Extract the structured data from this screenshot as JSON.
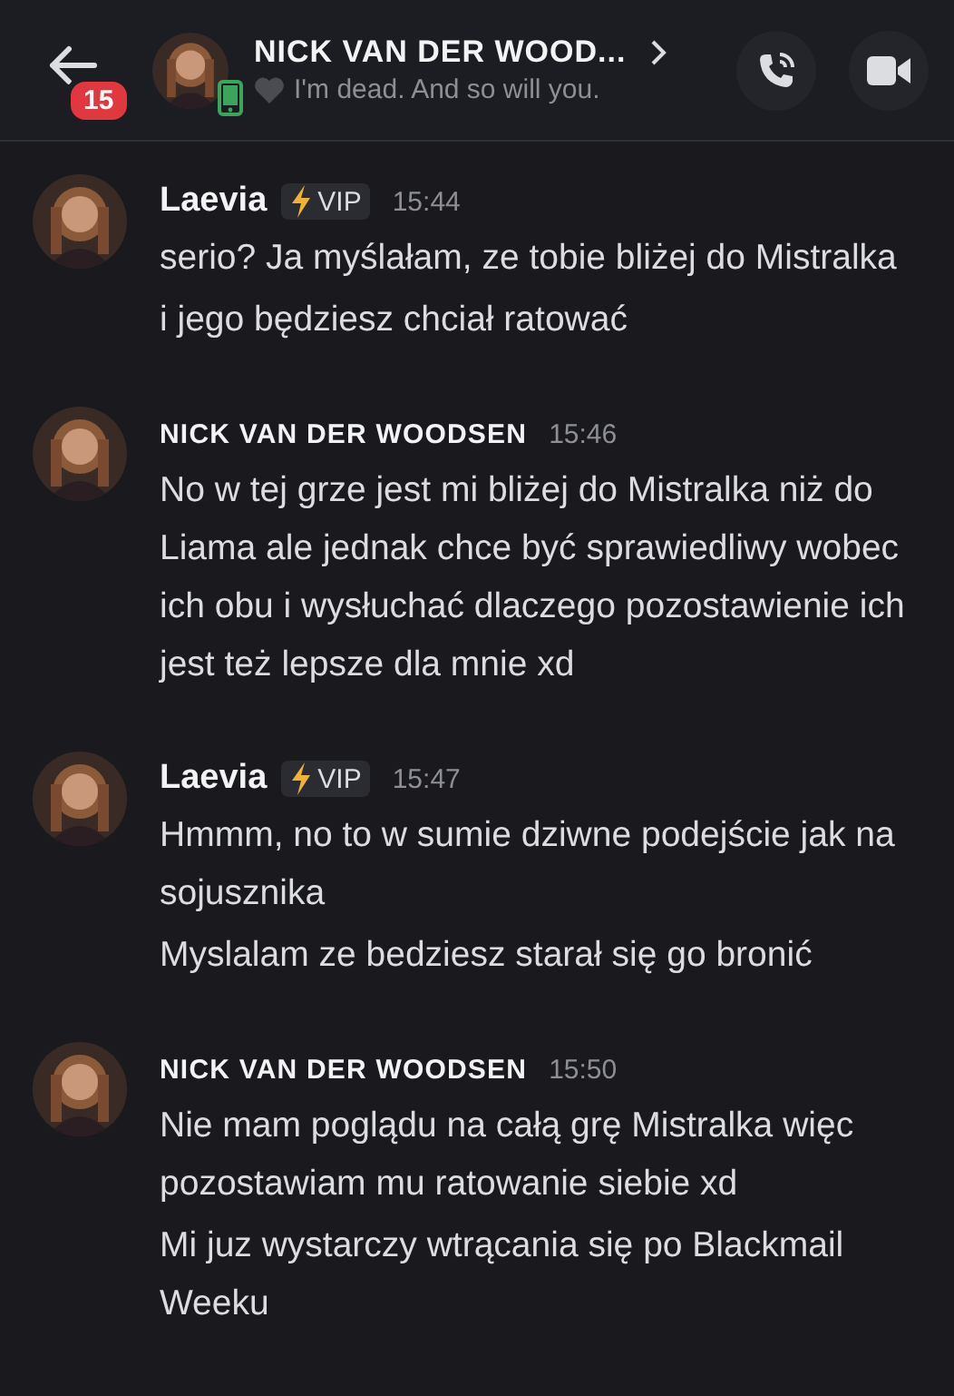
{
  "header": {
    "unread_badge": "15",
    "title": "NICK VAN DER WOOD...",
    "status": "I'm dead. And so will you."
  },
  "groups": [
    {
      "author": "Laevia",
      "badge": "VIP",
      "time": "15:44",
      "lines": [
        "serio? Ja myślałam, ze tobie bliżej do Mistralka",
        "i jego będziesz chciał ratować"
      ]
    },
    {
      "author": "NICK VAN DER WOODSEN",
      "time": "15:46",
      "lines": [
        "No w tej grze jest mi bliżej do Mistralka niż do Liama ale jednak chce być sprawiedliwy wobec ich obu i wysłuchać dlaczego pozostawienie ich jest też lepsze dla mnie xd"
      ]
    },
    {
      "author": "Laevia",
      "badge": "VIP",
      "time": "15:47",
      "lines": [
        "Hmmm, no to w sumie dziwne podejście jak na sojusznika",
        "Myslalam ze bedziesz starał się go bronić"
      ]
    },
    {
      "author": "NICK VAN DER WOODSEN",
      "time": "15:50",
      "lines": [
        "Nie mam poglądu na całą grę Mistralka więc pozostawiam mu ratowanie siebie xd",
        "Mi juz wystarczy wtrącania się po Blackmail Weeku"
      ]
    }
  ]
}
